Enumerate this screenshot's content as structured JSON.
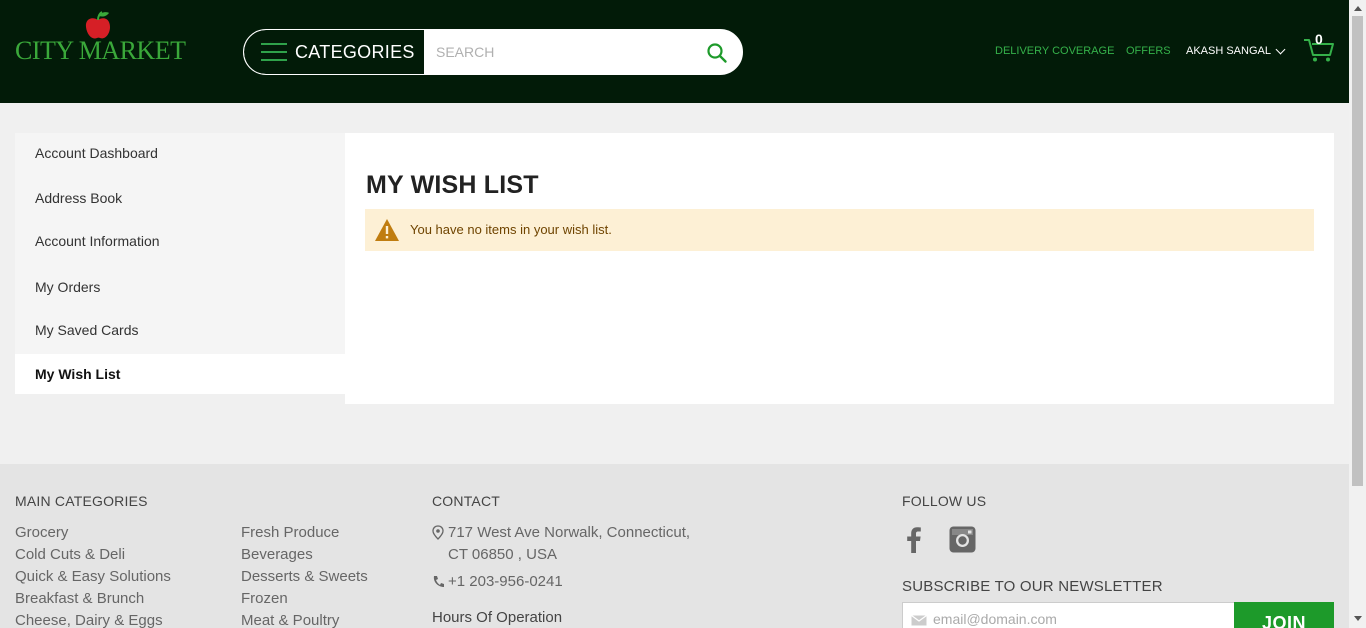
{
  "header": {
    "logo_text": "CITY MARKET",
    "categories_label": "CATEGORIES",
    "search_placeholder": "SEARCH",
    "nav": {
      "delivery": "DELIVERY COVERAGE",
      "offers": "OFFERS",
      "user": "AKASH SANGAL"
    },
    "cart_count": "0"
  },
  "sidebar": {
    "items": [
      {
        "label": "Account Dashboard"
      },
      {
        "label": "Address Book"
      },
      {
        "label": "Account Information"
      },
      {
        "label": "My Orders"
      },
      {
        "label": "My Saved Cards"
      },
      {
        "label": "My Wish List"
      }
    ]
  },
  "main": {
    "title": "MY WISH LIST",
    "notice": "You have no items in your wish list."
  },
  "footer": {
    "categories_heading": "MAIN CATEGORIES",
    "categories_col1": [
      "Grocery",
      "Cold Cuts & Deli",
      "Quick & Easy Solutions",
      "Breakfast & Brunch",
      "Cheese, Dairy & Eggs"
    ],
    "categories_col2": [
      "Fresh Produce",
      "Beverages",
      "Desserts & Sweets",
      "Frozen",
      "Meat & Poultry"
    ],
    "contact_heading": "CONTACT",
    "address_line1": "717 West Ave Norwalk, Connecticut,",
    "address_line2": "CT 06850 , USA",
    "phone": "+1 203-956-0241",
    "hours_heading": "Hours Of Operation",
    "follow_heading": "FOLLOW US",
    "newsletter_heading": "SUBSCRIBE TO OUR NEWSLETTER",
    "email_placeholder": "email@domain.com",
    "join_label": "JOIN"
  },
  "colors": {
    "header_bg": "#021b08",
    "accent_green": "#35b14a",
    "join_green": "#1d9a2a",
    "notice_bg": "#fdf0d5",
    "warning_icon": "#c07d10"
  }
}
